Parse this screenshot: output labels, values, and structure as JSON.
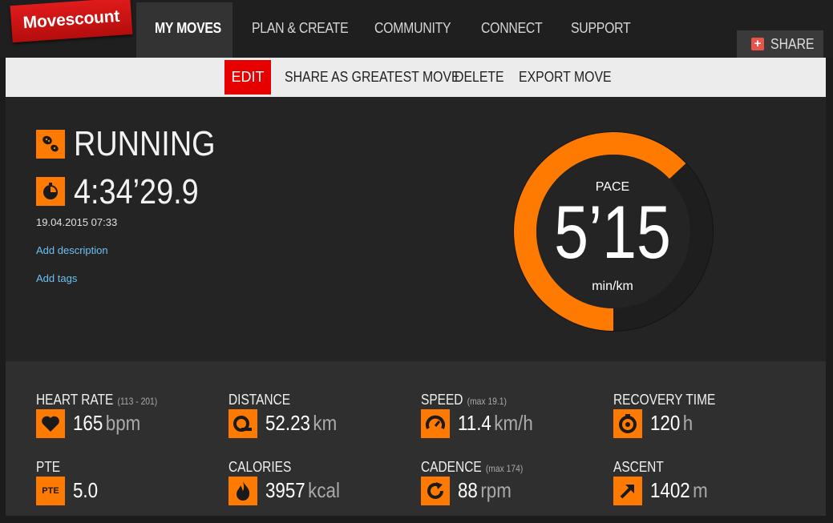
{
  "app": {
    "logo": "Movescount"
  },
  "nav": {
    "items": [
      "MY MOVES",
      "PLAN & CREATE",
      "COMMUNITY",
      "CONNECT",
      "SUPPORT"
    ],
    "active": "MY MOVES",
    "share_label": "SHARE"
  },
  "actions": {
    "edit": "EDIT",
    "share_greatest": "SHARE AS GREATEST MOVE",
    "delete": "DELETE",
    "export": "EXPORT MOVE"
  },
  "move": {
    "activity": "RUNNING",
    "duration": "4:34’29.9",
    "datetime": "19.04.2015 07:33",
    "add_description": "Add description",
    "add_tags": "Add tags"
  },
  "pace": {
    "label": "PACE",
    "value": "5’15",
    "unit": "min/km",
    "ring_fraction": 0.63
  },
  "colors": {
    "accent": "#ff7a00",
    "edit_red": "#e60000",
    "link": "#6cc0f0"
  },
  "stats": [
    {
      "title": "HEART RATE",
      "sub": "(113 - 201)",
      "value": "165",
      "unit": "bpm",
      "icon": "heart-icon"
    },
    {
      "title": "DISTANCE",
      "sub": "",
      "value": "52.23",
      "unit": "km",
      "icon": "tape-measure-icon"
    },
    {
      "title": "SPEED",
      "sub": "(max 19.1)",
      "value": "11.4",
      "unit": "km/h",
      "icon": "speedometer-icon"
    },
    {
      "title": "RECOVERY TIME",
      "sub": "",
      "value": "120",
      "unit": "h",
      "icon": "recovery-timer-icon"
    },
    {
      "title": "PTE",
      "sub": "",
      "value": "5.0",
      "unit": "",
      "icon": "pte-icon",
      "icon_text": "PTE"
    },
    {
      "title": "CALORIES",
      "sub": "",
      "value": "3957",
      "unit": "kcal",
      "icon": "flame-icon"
    },
    {
      "title": "CADENCE",
      "sub": "(max 174)",
      "value": "88",
      "unit": "rpm",
      "icon": "cadence-icon"
    },
    {
      "title": "ASCENT",
      "sub": "",
      "value": "1402",
      "unit": "m",
      "icon": "arrow-up-right-icon"
    }
  ]
}
